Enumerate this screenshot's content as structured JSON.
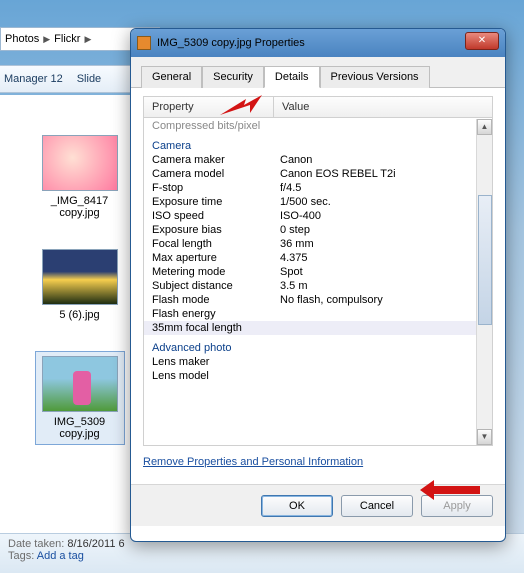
{
  "breadcrumb": {
    "seg1": "Photos",
    "seg2": "Flickr"
  },
  "toolbar": {
    "item1": "Manager 12",
    "item2": "Slide"
  },
  "thumbs": [
    {
      "label": "_IMG_8417 copy.jpg"
    },
    {
      "label": "5 (6).jpg"
    },
    {
      "label": "IMG_5309 copy.jpg"
    }
  ],
  "detailbar": {
    "date_label": "Date taken:",
    "date_value": "8/16/2011 6",
    "tags_label": "Tags:",
    "tags_link": "Add a tag"
  },
  "dialog": {
    "title": "IMG_5309 copy.jpg Properties",
    "tabs": {
      "general": "General",
      "security": "Security",
      "details": "Details",
      "previous": "Previous Versions"
    },
    "headers": {
      "property": "Property",
      "value": "Value"
    },
    "rows": {
      "compressed": "Compressed bits/pixel",
      "camera_hdr": "Camera",
      "maker_k": "Camera maker",
      "maker_v": "Canon",
      "model_k": "Camera model",
      "model_v": "Canon EOS REBEL T2i",
      "fstop_k": "F-stop",
      "fstop_v": "f/4.5",
      "exptime_k": "Exposure time",
      "exptime_v": "1/500 sec.",
      "iso_k": "ISO speed",
      "iso_v": "ISO-400",
      "expbias_k": "Exposure bias",
      "expbias_v": "0 step",
      "focal_k": "Focal length",
      "focal_v": "36 mm",
      "maxap_k": "Max aperture",
      "maxap_v": "4.375",
      "meter_k": "Metering mode",
      "meter_v": "Spot",
      "subj_k": "Subject distance",
      "subj_v": "3.5 m",
      "flash_k": "Flash mode",
      "flash_v": "No flash, compulsory",
      "flashen_k": "Flash energy",
      "f35_k": "35mm focal length",
      "adv_hdr": "Advanced photo",
      "lensmk_k": "Lens maker",
      "lensmd_k": "Lens model"
    },
    "remove_link": "Remove Properties and Personal Information",
    "buttons": {
      "ok": "OK",
      "cancel": "Cancel",
      "apply": "Apply"
    }
  }
}
